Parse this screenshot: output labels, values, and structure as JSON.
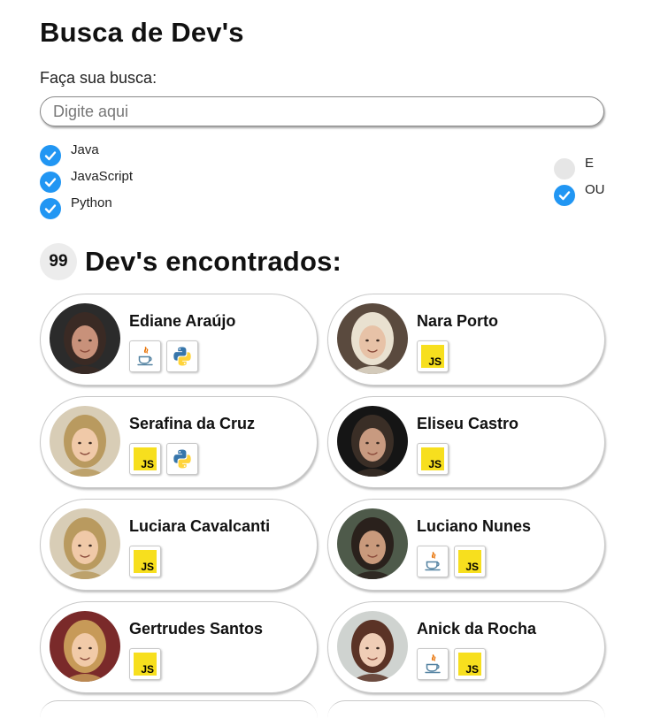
{
  "page": {
    "title": "Busca de Dev's"
  },
  "search": {
    "label": "Faça sua busca:",
    "placeholder": "Digite aqui",
    "value": ""
  },
  "filters": {
    "languages": [
      {
        "label": "Java",
        "checked": true
      },
      {
        "label": "JavaScript",
        "checked": true
      },
      {
        "label": "Python",
        "checked": true
      }
    ],
    "mode": [
      {
        "label": "E",
        "checked": false
      },
      {
        "label": "OU",
        "checked": true
      }
    ]
  },
  "results": {
    "count": "99",
    "title": "Dev's encontrados:",
    "devs": [
      {
        "name": "Ediane Araújo",
        "skills": [
          "java",
          "python"
        ],
        "avatar": {
          "bg": "#2b2b2b",
          "hair": "#3a2a24",
          "skin": "#c8917a"
        }
      },
      {
        "name": "Nara Porto",
        "skills": [
          "javascript"
        ],
        "avatar": {
          "bg": "#5a4a3e",
          "hair": "#e9e1d0",
          "skin": "#e7c2a7"
        }
      },
      {
        "name": "Serafina da Cruz",
        "skills": [
          "javascript",
          "python"
        ],
        "avatar": {
          "bg": "#d8cdb6",
          "hair": "#b99a5f",
          "skin": "#f0c9a8"
        }
      },
      {
        "name": "Eliseu Castro",
        "skills": [
          "javascript"
        ],
        "avatar": {
          "bg": "#151515",
          "hair": "#3a2e26",
          "skin": "#c89a80"
        }
      },
      {
        "name": "Luciara Cavalcanti",
        "skills": [
          "javascript"
        ],
        "avatar": {
          "bg": "#d8cdb6",
          "hair": "#b99a5f",
          "skin": "#f0c9a8"
        }
      },
      {
        "name": "Luciano Nunes",
        "skills": [
          "java",
          "javascript"
        ],
        "avatar": {
          "bg": "#4e5a4a",
          "hair": "#2a211c",
          "skin": "#c99a7c"
        }
      },
      {
        "name": "Gertrudes Santos",
        "skills": [
          "javascript"
        ],
        "avatar": {
          "bg": "#7a2a2a",
          "hair": "#c79a58",
          "skin": "#f1caa8"
        }
      },
      {
        "name": "Anick da Rocha",
        "skills": [
          "java",
          "javascript"
        ],
        "avatar": {
          "bg": "#cfd3d0",
          "hair": "#5b3326",
          "skin": "#efcdb6"
        }
      }
    ]
  },
  "colors": {
    "accent": "#2196f3",
    "js_yellow": "#f7df1e",
    "badge_bg": "#ececec"
  },
  "icons": {
    "checked": "check-icon",
    "java": "java-icon",
    "javascript": "javascript-icon",
    "python": "python-icon"
  }
}
